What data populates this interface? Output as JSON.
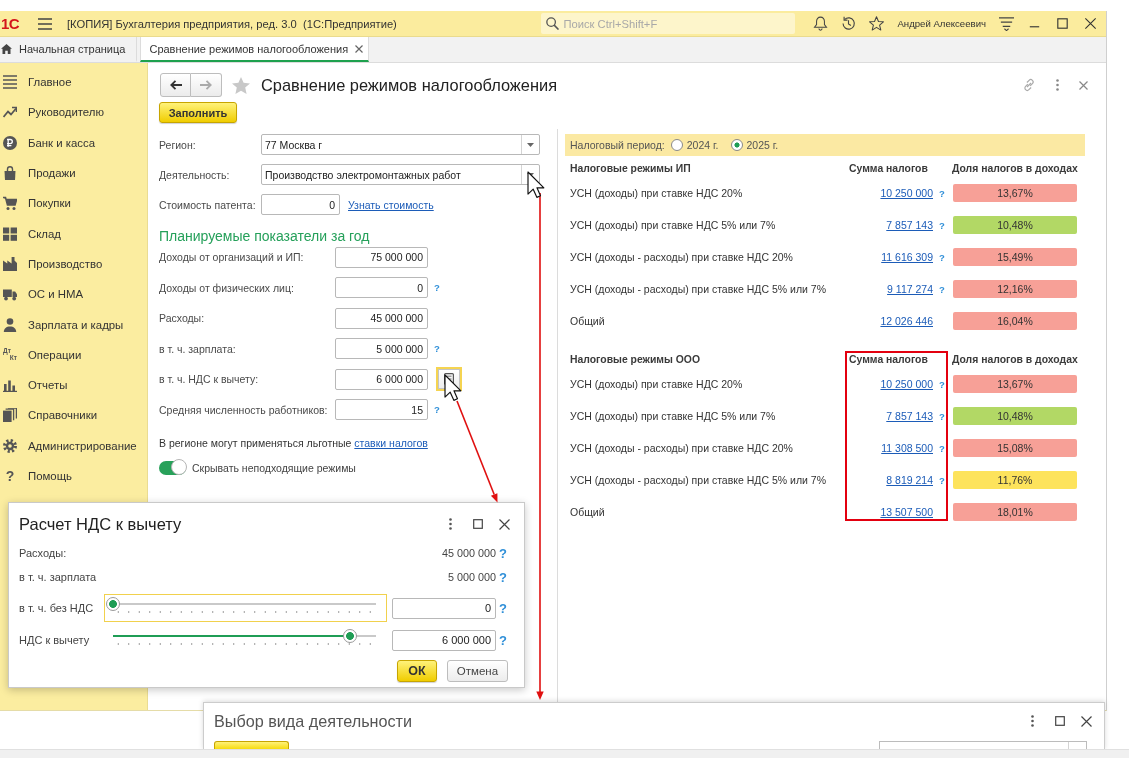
{
  "app_bar": {
    "logo": "1С",
    "title": "[КОПИЯ] Бухгалтерия предприятия, ред. 3.0  (1С:Предприятие)",
    "search": {
      "placeholder": "Поиск Ctrl+Shift+F"
    },
    "user": "Андрей Алексеевич"
  },
  "tabs": [
    {
      "kind": "home",
      "label": "Начальная страница",
      "selected": false
    },
    {
      "kind": "page",
      "label": "Сравнение режимов налогообложения",
      "selected": true
    }
  ],
  "sidebar": {
    "items": [
      {
        "label": "Главное"
      },
      {
        "label": "Руководителю"
      },
      {
        "label": "Банк и касса"
      },
      {
        "label": "Продажи"
      },
      {
        "label": "Покупки"
      },
      {
        "label": "Склад"
      },
      {
        "label": "Производство"
      },
      {
        "label": "ОС и НМА"
      },
      {
        "label": "Зарплата и кадры"
      },
      {
        "label": "Операции",
        "glyph": [
          "Дт",
          "Кт"
        ]
      },
      {
        "label": "Отчеты"
      },
      {
        "label": "Справочники"
      },
      {
        "label": "Администрирование"
      },
      {
        "label": "Помощь",
        "glyph": [
          "?"
        ]
      }
    ]
  },
  "form": {
    "nav": [
      {
        "kind": "back",
        "disabled": false
      },
      {
        "kind": "forward",
        "disabled": true
      }
    ],
    "title": "Сравнение режимов налогообложения",
    "fill_button": "Заполнить",
    "fields": [
      {
        "kind": "select",
        "label": "Регион:",
        "value": "77 Москва г"
      },
      {
        "kind": "select",
        "label": "Деятельность:",
        "value": "Производство электромонтажных работ"
      },
      {
        "kind": "number",
        "label": "Стоимость патента:",
        "value": "0",
        "link": "Узнать стоимость"
      }
    ],
    "plan_heading": "Планируемые показатели за год",
    "indicators": [
      {
        "kind": "input",
        "label": "Доходы от организаций и ИП:",
        "value": "75 000 000"
      },
      {
        "kind": "input",
        "label": "Доходы от физических лиц:",
        "value": "0",
        "help": "?"
      },
      {
        "kind": "input",
        "label": "Расходы:",
        "value": "45 000 000"
      },
      {
        "kind": "input",
        "label": "в т. ч. зарплата:",
        "value": "5 000 000",
        "help": "?"
      },
      {
        "kind": "calculator",
        "label": "в т. ч. НДС к вычету:",
        "value": "6 000 000",
        "focused": true
      },
      {
        "kind": "input",
        "label": "Средняя численность работников:",
        "value": "15",
        "help": "?"
      }
    ],
    "note": {
      "text": "В регионе могут применяться льготные",
      "link": "ставки налогов"
    },
    "toggle": {
      "label": "Скрывать неподходящие режимы",
      "on": true
    }
  },
  "comparison": {
    "period": {
      "label": "Налоговый период:",
      "options": [
        {
          "label": "2024 г.",
          "selected": false
        },
        {
          "label": "2025 г.",
          "selected": true
        }
      ]
    },
    "sections": [
      {
        "title": "Налоговые режимы ИП",
        "amount_header": "Сумма налогов",
        "share_header": "Доля налогов в доходах",
        "highlighted": false,
        "rows": [
          {
            "name": "УСН (доходы) при ставке НДС 20%",
            "amount": "10 250 000",
            "help": "?",
            "share": "13,67%",
            "color": "#f7a097"
          },
          {
            "name": "УСН (доходы) при ставке НДС 5% или 7%",
            "amount": "7 857 143",
            "help": "?",
            "share": "10,48%",
            "color": "#b2d865"
          },
          {
            "name": "УСН (доходы - расходы) при ставке НДС 20%",
            "amount": "11 616 309",
            "help": "?",
            "share": "15,49%",
            "color": "#f7a097"
          },
          {
            "name": "УСН (доходы - расходы) при ставке НДС 5% или 7%",
            "amount": "9 117 274",
            "help": "?",
            "share": "12,16%",
            "color": "#f7a097"
          },
          {
            "name": "Общий",
            "amount": "12 026 446",
            "share": "16,04%",
            "color": "#f7a097"
          }
        ]
      },
      {
        "title": "Налоговые режимы ООО",
        "amount_header": "Сумма налогов",
        "share_header": "Доля налогов в доходах",
        "highlighted": true,
        "rows": [
          {
            "name": "УСН (доходы) при ставке НДС 20%",
            "amount": "10 250 000",
            "help": "?",
            "share": "13,67%",
            "color": "#f7a097"
          },
          {
            "name": "УСН (доходы) при ставке НДС 5% или 7%",
            "amount": "7 857 143",
            "help": "?",
            "share": "10,48%",
            "color": "#b2d865"
          },
          {
            "name": "УСН (доходы - расходы) при ставке НДС 20%",
            "amount": "11 308 500",
            "help": "?",
            "share": "15,08%",
            "color": "#f7a097"
          },
          {
            "name": "УСН (доходы - расходы) при ставке НДС 5% или 7%",
            "amount": "8 819 214",
            "help": "?",
            "share": "11,76%",
            "color": "#fde35c"
          },
          {
            "name": "Общий",
            "amount": "13 507 500",
            "share": "18,01%",
            "color": "#f7a097"
          }
        ]
      }
    ]
  },
  "vat_dialog": {
    "title": "Расчет НДС к вычету",
    "rows": [
      {
        "kind": "value",
        "label": "Расходы:",
        "value": "45 000 000",
        "help": "?"
      },
      {
        "kind": "value",
        "label": "в т. ч. зарплата",
        "value": "5 000 000",
        "help": "?"
      },
      {
        "kind": "slider",
        "label": "в т. ч. без НДС",
        "level": 0,
        "value": "0",
        "help": "?",
        "focused": true
      },
      {
        "kind": "slider",
        "label": "НДС к вычету",
        "level": 0.9,
        "value": "6 000 000",
        "help": "?",
        "focused": false
      }
    ],
    "buttons": [
      {
        "kind": "primary",
        "label": "ОК"
      },
      {
        "kind": "secondary",
        "label": "Отмена"
      }
    ]
  },
  "activity_dialog": {
    "title": "Выбор вида деятельности"
  }
}
